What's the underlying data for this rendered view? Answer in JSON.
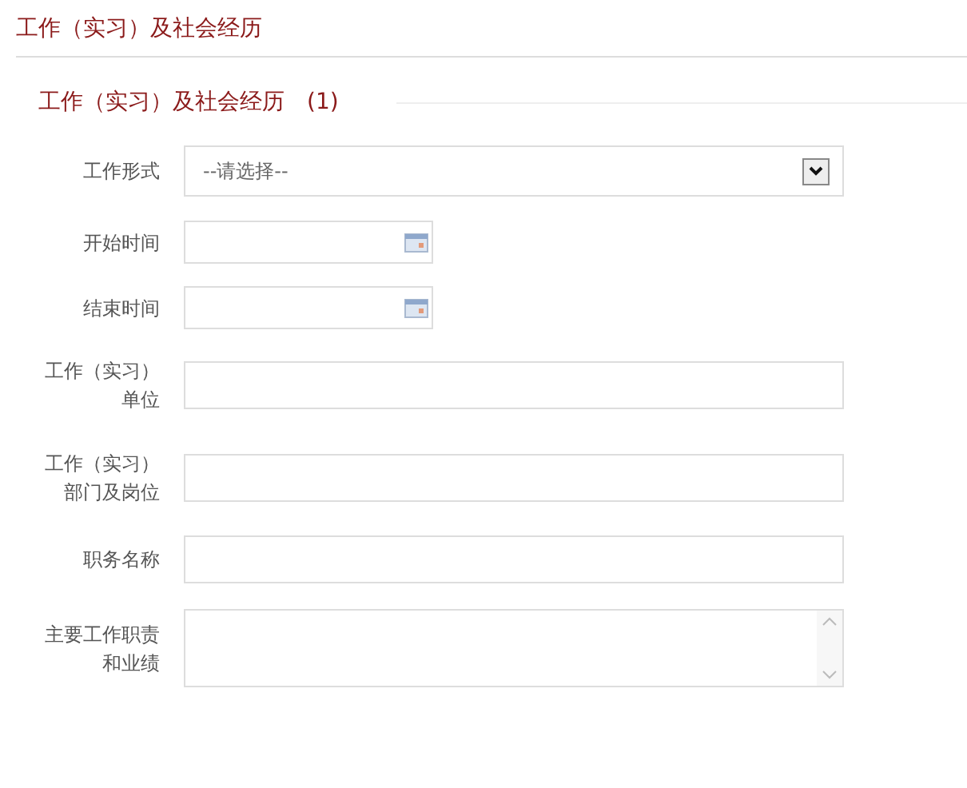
{
  "page_title": "工作（实习）及社会经历",
  "section": {
    "title": "工作（实习）及社会经历",
    "count": "(1)"
  },
  "fields": [
    {
      "kind": "select",
      "label_lines": [
        "工作形式"
      ],
      "value": "--请选择--"
    },
    {
      "kind": "date",
      "label_lines": [
        "开始时间"
      ]
    },
    {
      "kind": "date",
      "label_lines": [
        "结束时间"
      ]
    },
    {
      "kind": "text",
      "label_lines": [
        "工作（实习）",
        "单位"
      ]
    },
    {
      "kind": "text",
      "label_lines": [
        "工作（实习）",
        "部门及岗位"
      ]
    },
    {
      "kind": "text",
      "label_lines": [
        "职务名称"
      ]
    },
    {
      "kind": "textarea",
      "label_lines": [
        "主要工作职责",
        "和业绩"
      ]
    }
  ]
}
